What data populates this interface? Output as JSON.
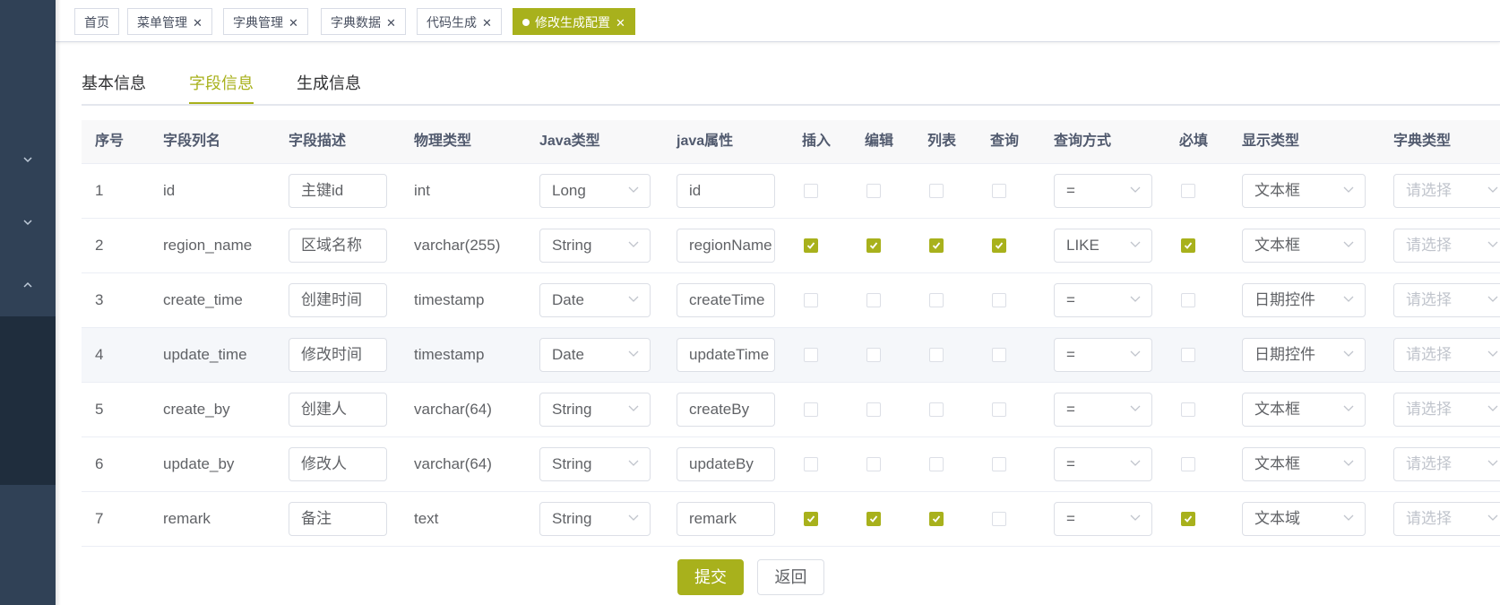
{
  "accent_color": "#a8b11c",
  "sidebar": {
    "icons": [
      "chevron-down-icon",
      "chevron-down-icon",
      "chevron-up-icon"
    ]
  },
  "tags": [
    {
      "label": "首页",
      "closable": false,
      "active": false
    },
    {
      "label": "菜单管理",
      "closable": true,
      "active": false
    },
    {
      "label": "字典管理",
      "closable": true,
      "active": false
    },
    {
      "label": "字典数据",
      "closable": true,
      "active": false
    },
    {
      "label": "代码生成",
      "closable": true,
      "active": false
    },
    {
      "label": "修改生成配置",
      "closable": true,
      "active": true
    }
  ],
  "tabs": [
    {
      "label": "基本信息",
      "active": false
    },
    {
      "label": "字段信息",
      "active": true
    },
    {
      "label": "生成信息",
      "active": false
    }
  ],
  "table": {
    "headers": [
      "序号",
      "字段列名",
      "字段描述",
      "物理类型",
      "Java类型",
      "java属性",
      "插入",
      "编辑",
      "列表",
      "查询",
      "查询方式",
      "必填",
      "显示类型",
      "字典类型"
    ],
    "rows": [
      {
        "no": "1",
        "column": "id",
        "desc": "主键id",
        "phys": "int",
        "java_type": "Long",
        "java_prop": "id",
        "insert": false,
        "edit": false,
        "list": false,
        "query": false,
        "query_type": "=",
        "required": false,
        "display": "文本框",
        "dict": "请选择"
      },
      {
        "no": "2",
        "column": "region_name",
        "desc": "区域名称",
        "phys": "varchar(255)",
        "java_type": "String",
        "java_prop": "regionName",
        "insert": true,
        "edit": true,
        "list": true,
        "query": true,
        "query_type": "LIKE",
        "required": true,
        "display": "文本框",
        "dict": "请选择"
      },
      {
        "no": "3",
        "column": "create_time",
        "desc": "创建时间",
        "phys": "timestamp",
        "java_type": "Date",
        "java_prop": "createTime",
        "insert": false,
        "edit": false,
        "list": false,
        "query": false,
        "query_type": "=",
        "required": false,
        "display": "日期控件",
        "dict": "请选择"
      },
      {
        "no": "4",
        "column": "update_time",
        "desc": "修改时间",
        "phys": "timestamp",
        "java_type": "Date",
        "java_prop": "updateTime",
        "insert": false,
        "edit": false,
        "list": false,
        "query": false,
        "query_type": "=",
        "required": false,
        "display": "日期控件",
        "dict": "请选择"
      },
      {
        "no": "5",
        "column": "create_by",
        "desc": "创建人",
        "phys": "varchar(64)",
        "java_type": "String",
        "java_prop": "createBy",
        "insert": false,
        "edit": false,
        "list": false,
        "query": false,
        "query_type": "=",
        "required": false,
        "display": "文本框",
        "dict": "请选择"
      },
      {
        "no": "6",
        "column": "update_by",
        "desc": "修改人",
        "phys": "varchar(64)",
        "java_type": "String",
        "java_prop": "updateBy",
        "insert": false,
        "edit": false,
        "list": false,
        "query": false,
        "query_type": "=",
        "required": false,
        "display": "文本框",
        "dict": "请选择"
      },
      {
        "no": "7",
        "column": "remark",
        "desc": "备注",
        "phys": "text",
        "java_type": "String",
        "java_prop": "remark",
        "insert": true,
        "edit": true,
        "list": true,
        "query": false,
        "query_type": "=",
        "required": true,
        "display": "文本域",
        "dict": "请选择"
      }
    ]
  },
  "buttons": {
    "submit": "提交",
    "back": "返回"
  }
}
